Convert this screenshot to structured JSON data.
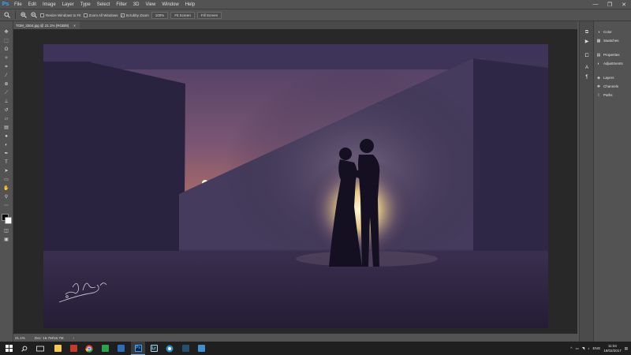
{
  "app": {
    "logo": "Ps",
    "menu": [
      "File",
      "Edit",
      "Image",
      "Layer",
      "Type",
      "Select",
      "Filter",
      "3D",
      "View",
      "Window",
      "Help"
    ],
    "window_controls": [
      "—",
      "❐",
      "✕"
    ]
  },
  "options_bar": {
    "resize_windows": "Resize Windows to Fit",
    "zoom_all": "Zoom All Windows",
    "scrubby_zoom": "Scrubby Zoom",
    "btn_100": "100%",
    "btn_fit": "Fit Screen",
    "btn_fill": "Fill Screen"
  },
  "document": {
    "tab_title": "TOM_3304.jpg @ 21.1% (RGB/8)",
    "tab_close": "×"
  },
  "status": {
    "zoom": "21.1%",
    "doc_size": "Doc: 16.7M/16.7M",
    "arrow": "›"
  },
  "panels": {
    "items": [
      "Color",
      "Swatches",
      "Properties",
      "Adjustments",
      "Layers",
      "Channels",
      "Paths"
    ]
  },
  "photo": {
    "signature": "Signature watermark"
  },
  "taskbar": {
    "lang": "ENG",
    "time": "11:04",
    "date": "18/02/2017",
    "apps": [
      "Ps",
      "Lr"
    ]
  },
  "colors": {
    "ui_bg": "#535353",
    "canvas_bg": "#282828",
    "photo_sky_top": "#4a3c63",
    "sun_glow": "#f3a75e",
    "spotlight": "#fff3c9",
    "accent_blue": "#31a8ff"
  }
}
